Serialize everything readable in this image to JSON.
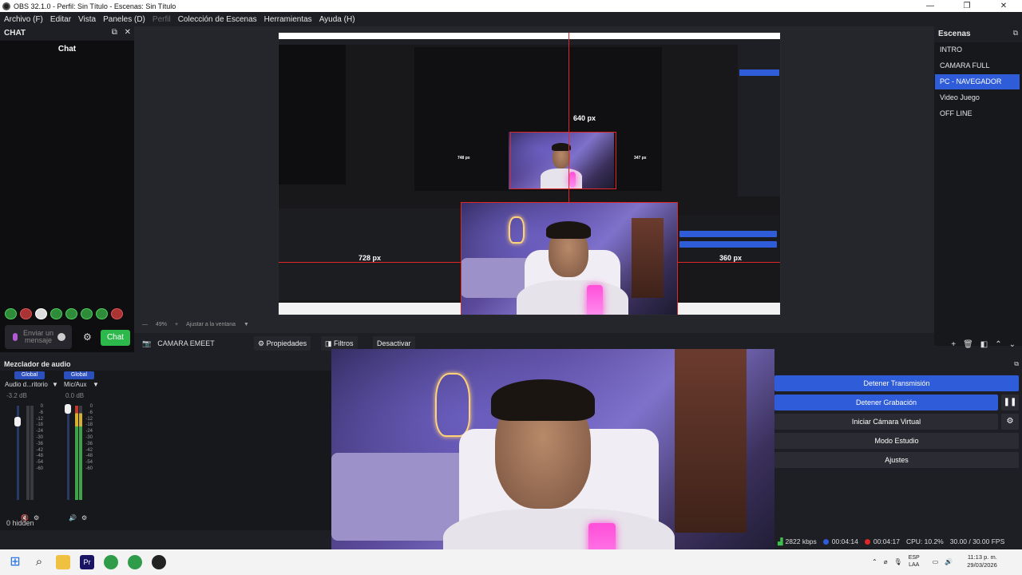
{
  "window": {
    "title": "OBS 32.1.0 - Perfil: Sin Título - Escenas: Sin Título",
    "buttons": [
      "—",
      "❐",
      "✕"
    ]
  },
  "menu": {
    "items": [
      "Archivo (F)",
      "Editar",
      "Vista",
      "Paneles (D)",
      "Perfil",
      "Colección de Escenas",
      "Herramientas",
      "Ayuda (H)"
    ]
  },
  "chat_dock": {
    "title": "CHAT",
    "heading": "Chat",
    "input_placeholder": "Enviar un mensaje",
    "send_label": "Chat"
  },
  "preview": {
    "px_labels": [
      "640 px",
      "728 px",
      "360 px",
      "748 px",
      "347 px"
    ],
    "zoom": "49%",
    "fit": "Ajustar a la ventana"
  },
  "scenes": {
    "title": "Escenas",
    "items": [
      {
        "label": "INTRO"
      },
      {
        "label": "CAMARA FULL"
      },
      {
        "label": "PC - NAVEGADOR"
      },
      {
        "label": "Video Juego"
      },
      {
        "label": "OFF LINE"
      }
    ],
    "active_index": 2
  },
  "source_toolbar": {
    "source_name": "CAMARA EMEET",
    "properties": "Propiedades",
    "filters": "Filtros",
    "deactivate": "Desactivar"
  },
  "mixer": {
    "title": "Mezclador de audio",
    "channels": [
      {
        "global": "Global",
        "name": "Audio d...ritorio",
        "db": "-3.2 dB",
        "level": 0.8
      },
      {
        "global": "Global",
        "name": "Mic/Aux",
        "db": "0.0 dB",
        "level": 0.95
      }
    ],
    "scale": [
      "0",
      "-6",
      "-12",
      "-18",
      "-24",
      "-30",
      "-36",
      "-42",
      "-48",
      "-54",
      "-60"
    ],
    "hidden": "0 hidden"
  },
  "controls": {
    "stop_stream": "Detener Transmisión",
    "stop_record": "Detener Grabación",
    "virtual_cam": "Iniciar Cámara Virtual",
    "studio_mode": "Modo Estudio",
    "settings": "Ajustes"
  },
  "status": {
    "bitrate": "2822 kbps",
    "stream_time": "00:04:14",
    "rec_time": "00:04:17",
    "cpu": "CPU: 10.2%",
    "fps": "30.00 / 30.00 FPS"
  },
  "taskbar": {
    "lang_top": "ESP",
    "lang_bottom": "LAA",
    "time": "11:13 p. m.",
    "date": "29/03/2026"
  },
  "colors": {
    "accent": "#2f5cd8",
    "send": "#2db84c",
    "guide": "#e02626"
  }
}
